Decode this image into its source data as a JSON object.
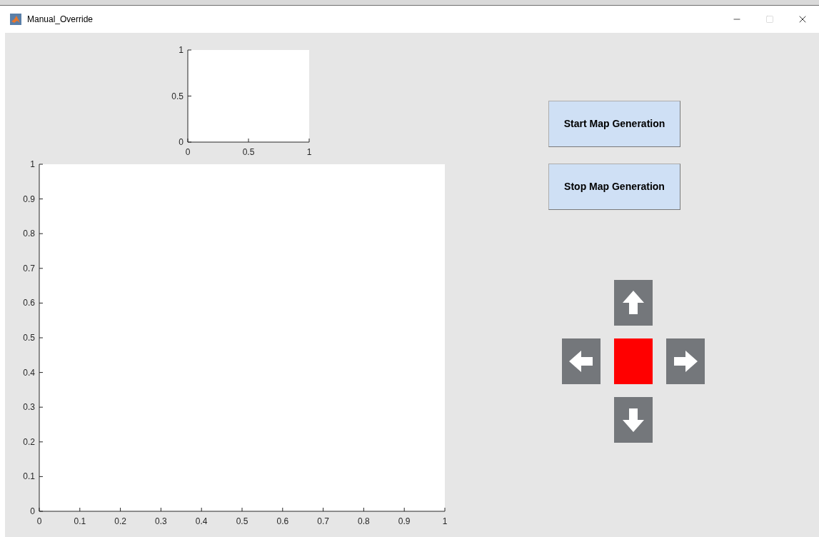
{
  "window": {
    "title": "Manual_Override"
  },
  "small_axes": {
    "chart_data": {
      "type": "line",
      "xlim": [
        0,
        1
      ],
      "ylim": [
        0,
        1
      ],
      "xticks": [
        {
          "value": 0,
          "label": "0"
        },
        {
          "value": 0.5,
          "label": "0.5"
        },
        {
          "value": 1,
          "label": "1"
        }
      ],
      "yticks": [
        {
          "value": 0,
          "label": "0"
        },
        {
          "value": 0.5,
          "label": "0.5"
        },
        {
          "value": 1,
          "label": "1"
        }
      ]
    }
  },
  "main_axes": {
    "chart_data": {
      "type": "line",
      "xlim": [
        0,
        1
      ],
      "ylim": [
        0,
        1
      ],
      "xticks": [
        {
          "value": 0,
          "label": "0"
        },
        {
          "value": 0.1,
          "label": "0.1"
        },
        {
          "value": 0.2,
          "label": "0.2"
        },
        {
          "value": 0.3,
          "label": "0.3"
        },
        {
          "value": 0.4,
          "label": "0.4"
        },
        {
          "value": 0.5,
          "label": "0.5"
        },
        {
          "value": 0.6,
          "label": "0.6"
        },
        {
          "value": 0.7,
          "label": "0.7"
        },
        {
          "value": 0.8,
          "label": "0.8"
        },
        {
          "value": 0.9,
          "label": "0.9"
        },
        {
          "value": 1,
          "label": "1"
        }
      ],
      "yticks": [
        {
          "value": 0,
          "label": "0"
        },
        {
          "value": 0.1,
          "label": "0.1"
        },
        {
          "value": 0.2,
          "label": "0.2"
        },
        {
          "value": 0.3,
          "label": "0.3"
        },
        {
          "value": 0.4,
          "label": "0.4"
        },
        {
          "value": 0.5,
          "label": "0.5"
        },
        {
          "value": 0.6,
          "label": "0.6"
        },
        {
          "value": 0.7,
          "label": "0.7"
        },
        {
          "value": 0.8,
          "label": "0.8"
        },
        {
          "value": 0.9,
          "label": "0.9"
        },
        {
          "value": 1,
          "label": "1"
        }
      ]
    }
  },
  "buttons": [
    "Start Map Generation",
    "Stop Map Generation"
  ],
  "dpad": [
    {
      "kind": "up"
    },
    {
      "kind": "left"
    },
    {
      "kind": "center",
      "color": "#ff0000"
    },
    {
      "kind": "right"
    },
    {
      "kind": "down"
    }
  ]
}
